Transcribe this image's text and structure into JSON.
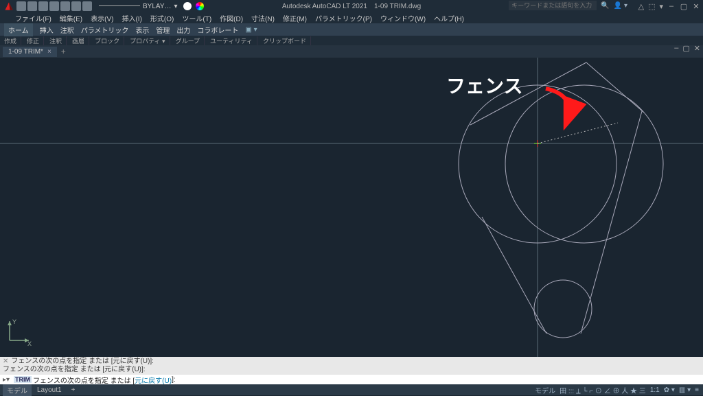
{
  "title": {
    "app": "Autodesk AutoCAD LT 2021",
    "doc": "1-09 TRIM.dwg"
  },
  "search": {
    "placeholder": "キーワードまたは語句を入力"
  },
  "menu": {
    "items": [
      "ファイル(F)",
      "編集(E)",
      "表示(V)",
      "挿入(I)",
      "形式(O)",
      "ツール(T)",
      "作図(D)",
      "寸法(N)",
      "修正(M)",
      "パラメトリック(P)",
      "ウィンドウ(W)",
      "ヘルプ(H)"
    ]
  },
  "layer_sel": "BYLAY…",
  "ribbon_tabs": [
    "ホーム",
    "挿入",
    "注釈",
    "パラメトリック",
    "表示",
    "管理",
    "出力",
    "コラボレート"
  ],
  "ribbon_panels": [
    "作成",
    "修正",
    "注釈",
    "画層",
    "ブロック",
    "プロパティ ▾",
    "グループ",
    "ユーティリティ",
    "クリップボード"
  ],
  "doc_tab": {
    "label": "1-09 TRIM*"
  },
  "annotation": "フェンス",
  "ucs": {
    "x": "X",
    "y": "Y"
  },
  "cmd_hist": [
    "フェンスの次の点を指定 または [元に戻す(U)]:",
    "フェンスの次の点を指定 または [元に戻す(U)]:"
  ],
  "cmd": {
    "chev": "▸▾",
    "kw": "TRIM",
    "text_a": "フェンスの次の点を指定 または [",
    "link": "元に戻す(U)",
    "text_b": "]:"
  },
  "status": {
    "tab_model": "モデル",
    "tab_layout": "Layout1",
    "plus": "+",
    "scale": "1:1",
    "snap": "田 ::: ⟂ └ ⌐ ⊙ ∠ ⊕ 人 ★ 三",
    "menu": "≡"
  },
  "winbtns": {
    "min": "–",
    "max": "▢",
    "close": "✕"
  },
  "docwin": {
    "min": "–",
    "max": "▢",
    "close": "✕"
  }
}
